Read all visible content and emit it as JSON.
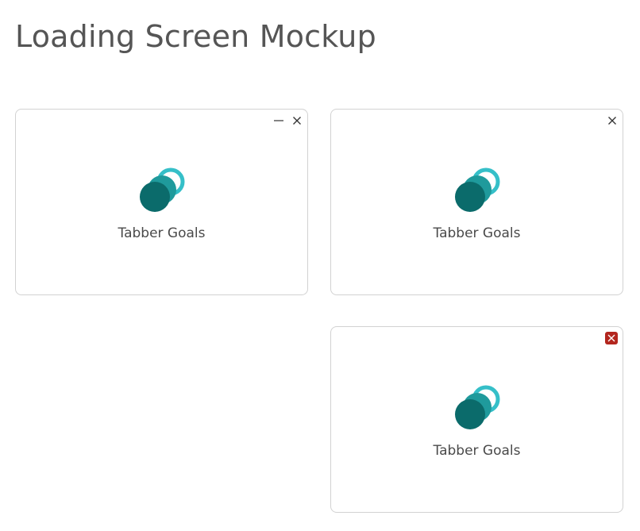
{
  "page": {
    "title": "Loading Screen Mockup"
  },
  "windows": [
    {
      "app_name": "Tabber Goals",
      "controls": [
        "minimize-icon",
        "close-icon"
      ],
      "close_state": "normal"
    },
    {
      "app_name": "Tabber Goals",
      "controls": [
        "close-icon"
      ],
      "close_state": "normal"
    },
    {
      "app_name": "Tabber Goals",
      "controls": [
        "close-icon"
      ],
      "close_state": "hover"
    }
  ],
  "colors": {
    "logo_ring": "#35bfc8",
    "logo_mid": "#1f9a9c",
    "logo_front": "#0b6b6b",
    "close_hover_bg": "#b3261e",
    "border": "#d2d2d2",
    "text": "#4a4a4a"
  }
}
